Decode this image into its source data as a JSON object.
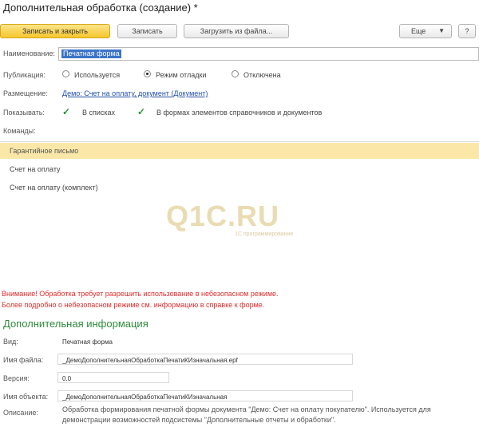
{
  "window": {
    "title": "Дополнительная обработка (создание) *"
  },
  "toolbar": {
    "save_close_label": "Записать и закрыть",
    "save_label": "Записать",
    "load_label": "Загрузить из файла...",
    "more_label": "Еще",
    "help_label": "?"
  },
  "form": {
    "name_label": "Наименование:",
    "name_value": "Печатная форма",
    "publication_label": "Публикация:",
    "publication_options": [
      "Используется",
      "Режим отладки",
      "Отключена"
    ],
    "publication_selected": 1,
    "placement_label": "Размещение:",
    "placement_link": "Демо: Счет на оплату, документ (Документ)",
    "show_label": "Показывать:",
    "show_in_lists": "В списках",
    "show_in_forms": "В формах элементов справочников и документов",
    "commands_label": "Команды:"
  },
  "commands": [
    {
      "label": "Гарантийное письмо",
      "selected": true
    },
    {
      "label": "Счет на оплату",
      "selected": false
    },
    {
      "label": "Счет на оплату (комплект)",
      "selected": false
    }
  ],
  "watermark": {
    "text": "Q1C.RU",
    "sub": "1С программирование"
  },
  "warnings": [
    "Внимание! Обработка требует разрешить использование в небезопасном режиме.",
    "Более подробно о небезопасном режиме см. информацию в справке к форме."
  ],
  "info": {
    "section_title": "Дополнительная информация",
    "kind_label": "Вид:",
    "kind_value": "Печатная форма",
    "file_label": "Имя файла:",
    "file_value": "_ДемоДополнительнаяОбработкаПечатиКИзначальная.epf",
    "version_label": "Версия:",
    "version_value": "0.0",
    "object_label": "Имя объекта:",
    "object_value": "_ДемоДополнительнаяОбработкаПечатиКИзначальная",
    "description_label": "Описание:",
    "description_value": "Обработка формирования печатной формы документа \"Демо: Счет на оплату покупателю\". Используется для демонстрации возможностей подсистемы \"Дополнительные отчеты и обработки\"."
  },
  "colors": {
    "primary_button": "#f5c62e",
    "selection": "#fbe8a8",
    "link": "#2450a8",
    "warning": "#e12b2b",
    "section": "#2e8b3c",
    "check": "#1f9a2d"
  }
}
